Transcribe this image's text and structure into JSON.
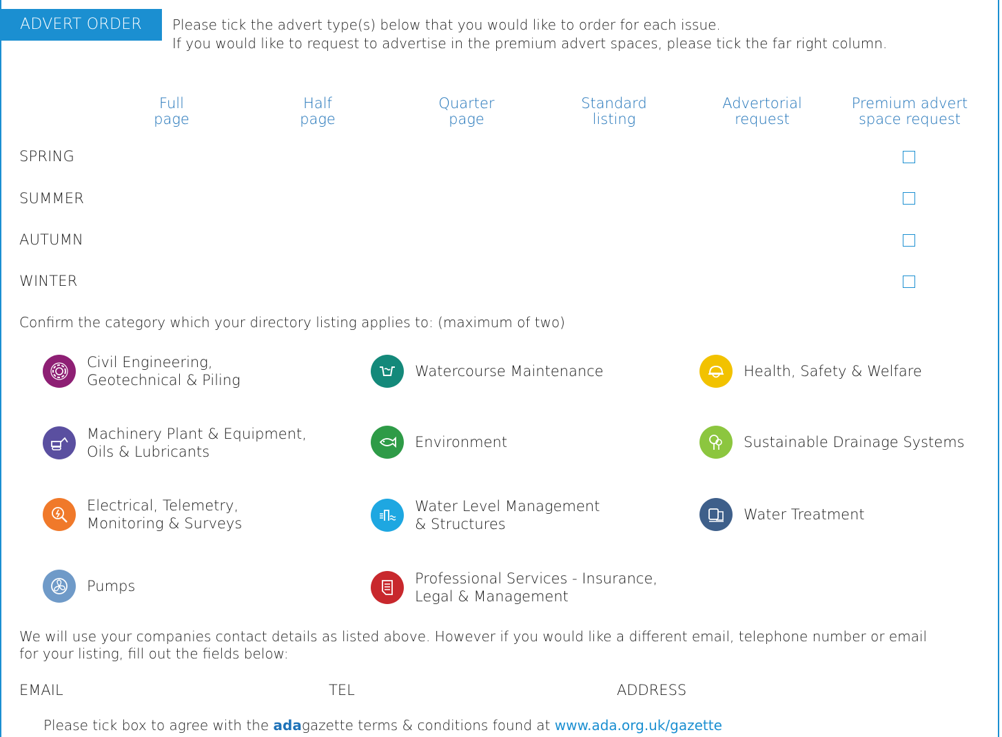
{
  "header": {
    "tag": "ADVERT ORDER",
    "line1": "Please tick the advert type(s) below that you would like to order for each issue.",
    "line2": "If you would like to request to advertise in the premium advert spaces, please tick the far right column."
  },
  "columns": [
    {
      "l1": "Full",
      "l2": "page"
    },
    {
      "l1": "Half",
      "l2": "page"
    },
    {
      "l1": "Quarter",
      "l2": "page"
    },
    {
      "l1": "Standard",
      "l2": "listing"
    },
    {
      "l1": "Advertorial",
      "l2": "request"
    },
    {
      "l1": "Premium advert",
      "l2": "space request"
    }
  ],
  "seasons": [
    "SPRING",
    "SUMMER",
    "AUTUMN",
    "WINTER"
  ],
  "category_prompt": "Confirm the category which your directory listing applies to: (maximum of two)",
  "categories": [
    {
      "l1": "Civil Engineering,",
      "l2": "Geotechnical & Piling",
      "icon": "gear-icon",
      "color": "#8e1f74"
    },
    {
      "l1": "Watercourse Maintenance",
      "l2": "",
      "icon": "watercourse-icon",
      "color": "#14897a"
    },
    {
      "l1": "Health, Safety & Welfare",
      "l2": "",
      "icon": "hardhat-icon",
      "color": "#f2c200"
    },
    {
      "l1": "Machinery Plant & Equipment,",
      "l2": "Oils & Lubricants",
      "icon": "excavator-icon",
      "color": "#5a4fa0"
    },
    {
      "l1": "Environment",
      "l2": "",
      "icon": "fish-icon",
      "color": "#2e9b47"
    },
    {
      "l1": "Sustainable Drainage Systems",
      "l2": "",
      "icon": "tree-icon",
      "color": "#8cc63f"
    },
    {
      "l1": "Electrical, Telemetry,",
      "l2": "Monitoring & Surveys",
      "icon": "electrical-icon",
      "color": "#f0792a"
    },
    {
      "l1": "Water Level Management",
      "l2": "& Structures",
      "icon": "water-level-icon",
      "color": "#1ea7e1"
    },
    {
      "l1": "Water Treatment",
      "l2": "",
      "icon": "water-treatment-icon",
      "color": "#3e5f8a"
    },
    {
      "l1": "Pumps",
      "l2": "",
      "icon": "pump-icon",
      "color": "#6f9ac8"
    },
    {
      "l1": "Professional Services - Insurance,",
      "l2": "Legal & Management",
      "icon": "document-icon",
      "color": "#c8282d"
    }
  ],
  "contact": {
    "line1": "We will use your companies contact details as listed above. However if you would like a different email, telephone number or email",
    "line2": "for your listing, fill out the fields below:",
    "email_label": "EMAIL",
    "tel_label": "TEL",
    "address_label": "ADDRESS"
  },
  "terms": {
    "prefix": "Please tick box to agree with the ",
    "brand_bold": "ada",
    "brand_rest": "gazette terms & conditions found at ",
    "link": "www.ada.org.uk/gazette"
  },
  "colors": {
    "accent": "#1b8fd1",
    "header_text": "#1e72b8"
  }
}
